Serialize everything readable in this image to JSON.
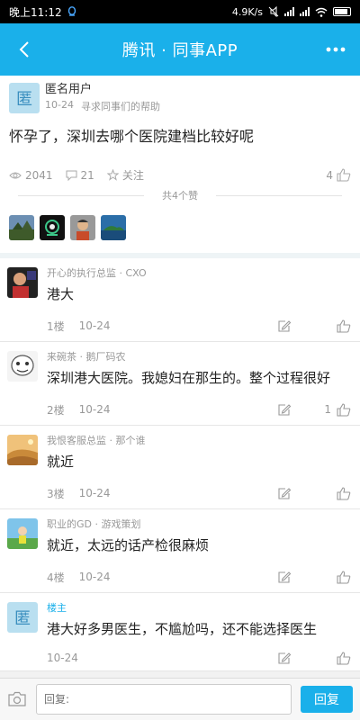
{
  "status_bar": {
    "time": "晚上11:12",
    "network_speed": "4.9K/s"
  },
  "nav": {
    "title": "腾讯 · 同事APP",
    "back_icon": "back-arrow-icon",
    "more_icon": "more-dots-icon",
    "color": "#1ab0ea"
  },
  "post": {
    "avatar_char": "匿",
    "author": "匿名用户",
    "date": "10-24",
    "category": "寻求同事们的帮助",
    "content": "怀孕了，深圳去哪个医院建档比较好呢",
    "views": "2041",
    "comments": "21",
    "follow_label": "关注",
    "likes": "4",
    "likes_total_label": "共4个赞"
  },
  "comments": [
    {
      "author": "开心的执行总监 · CXO",
      "content": "港大",
      "floor": "1楼",
      "date": "10-24",
      "likes": ""
    },
    {
      "author": "来碗茶 · 鹅厂码农",
      "content": "深圳港大医院。我媳妇在那生的。整个过程很好",
      "floor": "2楼",
      "date": "10-24",
      "likes": "1"
    },
    {
      "author": "我恨客服总监 · 那个谁",
      "content": "就近",
      "floor": "3楼",
      "date": "10-24",
      "likes": ""
    },
    {
      "author": "职业的GD · 游戏策划",
      "content": "就近，太远的话产检很麻烦",
      "floor": "4楼",
      "date": "10-24",
      "likes": ""
    },
    {
      "author": "楼主",
      "avatar_char": "匿",
      "content": "港大好多男医生，不尴尬吗，还不能选择医生",
      "floor": "",
      "date": "10-24",
      "likes": ""
    }
  ],
  "reply_bar": {
    "placeholder": "回复:",
    "button_label": "回复"
  }
}
